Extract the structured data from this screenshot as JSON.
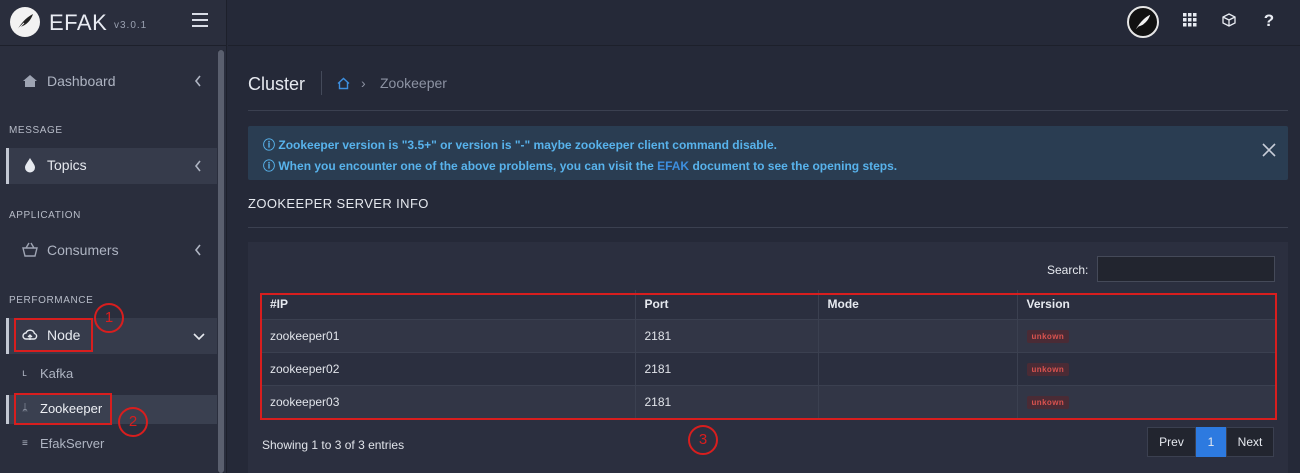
{
  "brand": {
    "name": "EFAK",
    "version": "v3.0.1"
  },
  "sidebar": {
    "dashboard": "Dashboard",
    "section_message": "MESSAGE",
    "topics": "Topics",
    "section_application": "APPLICATION",
    "consumers": "Consumers",
    "section_performance": "PERFORMANCE",
    "node": "Node",
    "node_children": [
      "Kafka",
      "Zookeeper",
      "EfakServer"
    ]
  },
  "annotations": [
    "1",
    "2",
    "3"
  ],
  "topbar": {
    "icons": [
      "avatar-icon",
      "apps-grid-icon",
      "cube-icon",
      "help-icon"
    ],
    "help": "?"
  },
  "page": {
    "title": "Cluster",
    "breadcrumb_current": "Zookeeper"
  },
  "alert": {
    "line1": "Zookeeper version is \"3.5+\" or version is \"-\" maybe zookeeper client command disable.",
    "line2_before": "When you encounter one of the above problems, you can visit the",
    "line2_link": "EFAK",
    "line2_after": "document to see the opening steps."
  },
  "section_title": "ZOOKEEPER SERVER INFO",
  "table": {
    "search_label": "Search:",
    "search_value": "",
    "columns": [
      "#IP",
      "Port",
      "Mode",
      "Version"
    ],
    "rows": [
      {
        "ip": "zookeeper01",
        "port": "2181",
        "mode": "",
        "version": "unkown"
      },
      {
        "ip": "zookeeper02",
        "port": "2181",
        "mode": "",
        "version": "unkown"
      },
      {
        "ip": "zookeeper03",
        "port": "2181",
        "mode": "",
        "version": "unkown"
      }
    ],
    "info": "Showing 1 to 3 of 3 entries",
    "pager": {
      "prev": "Prev",
      "current": "1",
      "next": "Next"
    }
  },
  "colors": {
    "accent": "#2d7ae0",
    "annotation": "#d81e1e",
    "alert_text": "#58b3ec",
    "badge_text": "#d9534f"
  }
}
